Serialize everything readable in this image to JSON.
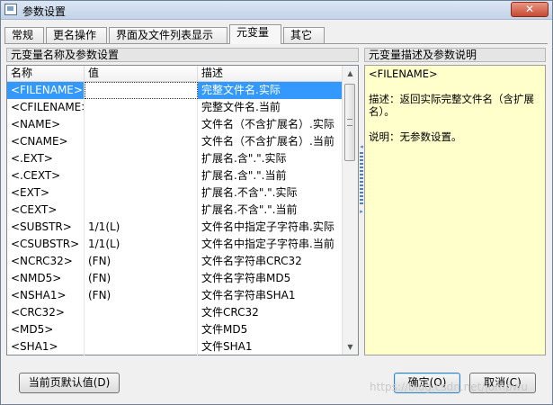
{
  "window": {
    "title": "参数设置",
    "close": "✕"
  },
  "tabs": [
    {
      "label": "常规"
    },
    {
      "label": "更名操作"
    },
    {
      "label": "界面及文件列表显示"
    },
    {
      "label": "元变量"
    },
    {
      "label": "其它"
    }
  ],
  "left": {
    "title": "元变量名称及参数设置",
    "columns": [
      "名称",
      "值",
      "描述"
    ],
    "rows": [
      {
        "name": "<FILENAME>",
        "value": "",
        "desc": "完整文件名.实际"
      },
      {
        "name": "<CFILENAME>",
        "value": "",
        "desc": "完整文件名.当前"
      },
      {
        "name": "<NAME>",
        "value": "",
        "desc": "文件名（不含扩展名）.实际"
      },
      {
        "name": "<CNAME>",
        "value": "",
        "desc": "文件名（不含扩展名）.当前"
      },
      {
        "name": "<.EXT>",
        "value": "",
        "desc": "扩展名.含\".\".实际"
      },
      {
        "name": "<.CEXT>",
        "value": "",
        "desc": "扩展名.含\".\".当前"
      },
      {
        "name": "<EXT>",
        "value": "",
        "desc": "扩展名.不含\".\".实际"
      },
      {
        "name": "<CEXT>",
        "value": "",
        "desc": "扩展名.不含\".\".当前"
      },
      {
        "name": "<SUBSTR>",
        "value": "1/1(L)",
        "desc": "文件名中指定子字符串.实际"
      },
      {
        "name": "<CSUBSTR>",
        "value": "1/1(L)",
        "desc": "文件名中指定子字符串.当前"
      },
      {
        "name": "<NCRC32>",
        "value": "(FN)",
        "desc": "文件名字符串CRC32"
      },
      {
        "name": "<NMD5>",
        "value": "(FN)",
        "desc": "文件名字符串MD5"
      },
      {
        "name": "<NSHA1>",
        "value": "(FN)",
        "desc": "文件名字符串SHA1"
      },
      {
        "name": "<CRC32>",
        "value": "",
        "desc": "文件CRC32"
      },
      {
        "name": "<MD5>",
        "value": "",
        "desc": "文件MD5"
      },
      {
        "name": "<SHA1>",
        "value": "",
        "desc": "文件SHA1"
      }
    ]
  },
  "right": {
    "title": "元变量描述及参数说明",
    "var": "<FILENAME>",
    "desc": "描述：返回实际完整文件名（含扩展名）。",
    "note": "说明：无参数设置。"
  },
  "buttons": {
    "reset": "当前页默认值(D)",
    "ok": "确定(O)",
    "cancel": "取消(C)"
  },
  "watermark": "https://blog.csdn.net/jumpwu"
}
